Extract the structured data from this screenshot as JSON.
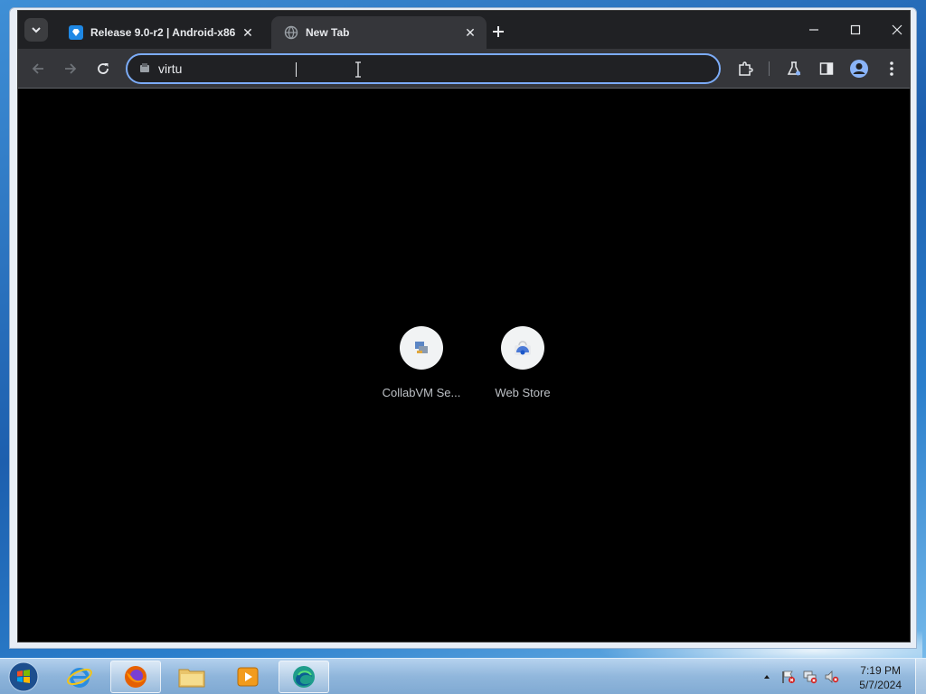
{
  "browser": {
    "tabs": [
      {
        "title": "Release 9.0-r2 | Android-x86",
        "active": false
      },
      {
        "title": "New Tab",
        "active": true
      }
    ],
    "omnibox": {
      "value": "virtu",
      "placeholder": ""
    },
    "accent_color": "#7cacf8"
  },
  "new_tab_page": {
    "shortcuts": [
      {
        "label": "CollabVM Se...",
        "icon": "collabvm-icon"
      },
      {
        "label": "Web Store",
        "icon": "web-store-icon"
      }
    ]
  },
  "taskbar": {
    "apps": [
      "internet-explorer-icon",
      "firefox-icon",
      "file-explorer-icon",
      "media-player-icon",
      "edge-icon"
    ],
    "clock": {
      "time": "7:19 PM",
      "date": "5/7/2024"
    }
  }
}
